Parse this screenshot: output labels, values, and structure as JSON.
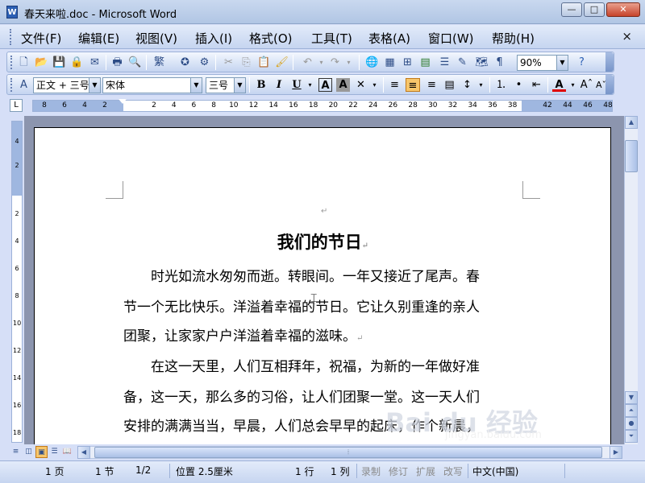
{
  "window": {
    "title": "春天来啦.doc - Microsoft Word",
    "icon_label": "W",
    "min_label": "—",
    "max_label": "□",
    "close_label": "✕"
  },
  "menu": {
    "items": [
      "文件(F)",
      "编辑(E)",
      "视图(V)",
      "插入(I)",
      "格式(O)",
      "工具(T)",
      "表格(A)",
      "窗口(W)",
      "帮助(H)"
    ],
    "doc_close": "×"
  },
  "standard_toolbar": {
    "zoom": "90%"
  },
  "format_toolbar": {
    "style": "正文 + 三号",
    "font": "宋体",
    "size": "三号",
    "bold": "B",
    "italic": "I",
    "underline": "U",
    "font_color_label": "A",
    "active_alignment": "center"
  },
  "ruler": {
    "ticks": [
      "8",
      "6",
      "4",
      "2",
      "2",
      "4",
      "6",
      "8",
      "10",
      "12",
      "14",
      "16",
      "18",
      "20",
      "22",
      "24",
      "26",
      "28",
      "30",
      "32",
      "34",
      "36",
      "38",
      "42",
      "44",
      "46",
      "48"
    ],
    "vticks": [
      "4",
      "2",
      "2",
      "4",
      "6",
      "8",
      "10",
      "12",
      "14",
      "16",
      "18"
    ]
  },
  "document": {
    "title": "我们的节日",
    "lines": [
      "　　时光如流水匆匆而逝。转眼间。一年又接近了尾声。春",
      "节一个无比快乐。洋溢着幸福的节日。它让久别重逢的亲人",
      "团聚，让家家户户洋溢着幸福的滋味。",
      "　　在这一天里，人们互相拜年，祝福，为新的一年做好准",
      "备，这一天，那么多的习俗，让人们团聚一堂。这一天人们",
      "安排的满满当当，早晨，人们总会早早的起床，作个新晨，"
    ],
    "para_mark": "↵"
  },
  "status": {
    "page": "1 页",
    "section": "1 节",
    "page_of": "1/2",
    "position": "位置 2.5厘米",
    "line": "1 行",
    "column": "1 列",
    "rec": "录制",
    "trk": "修订",
    "ext": "扩展",
    "ovr": "改写",
    "language": "中文(中国)"
  },
  "watermark": {
    "text": "Bai du 经验",
    "url": "jingyan.baidu.com"
  }
}
